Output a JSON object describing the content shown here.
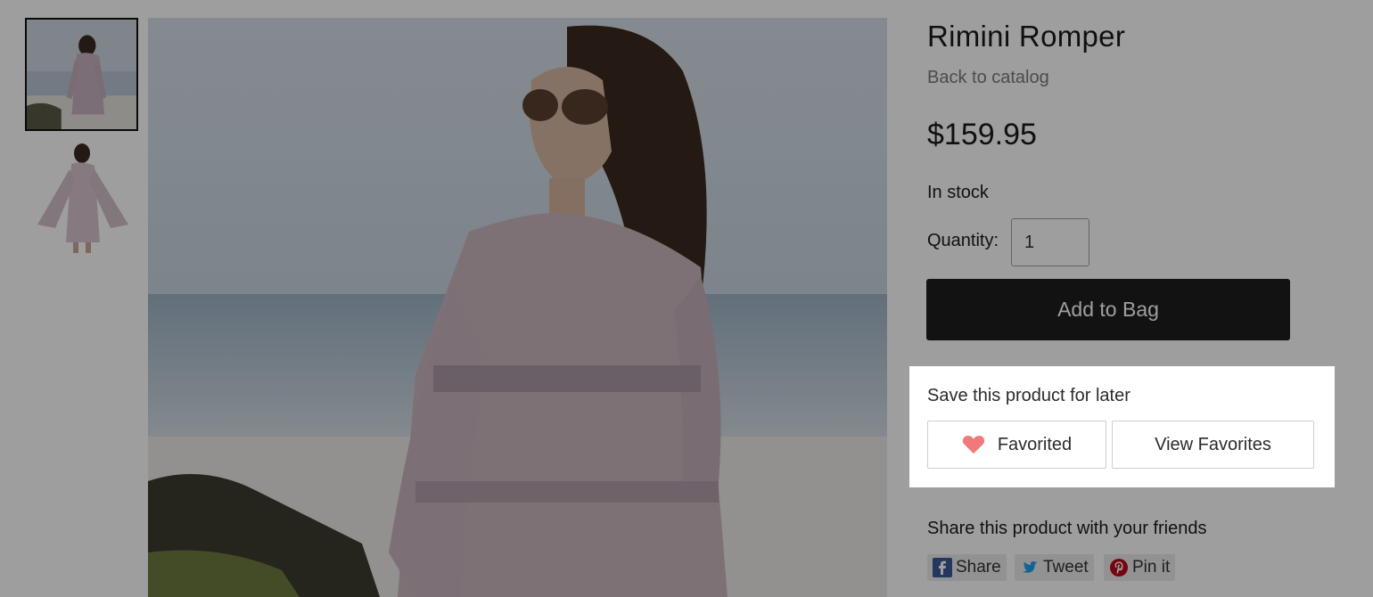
{
  "product": {
    "title": "Rimini Romper",
    "back_link": "Back to catalog",
    "price": "$159.95",
    "stock_status": "In stock",
    "quantity_label": "Quantity:",
    "quantity_value": "1",
    "add_button": "Add to Bag"
  },
  "favorites": {
    "heading": "Save this product for later",
    "favorited_label": "Favorited",
    "view_label": "View Favorites",
    "heart_color": "#f07a7a",
    "state": "favorited"
  },
  "share": {
    "heading": "Share this product with your friends",
    "buttons": [
      {
        "label": "Share",
        "icon": "facebook-icon",
        "color": "#3b5998"
      },
      {
        "label": "Tweet",
        "icon": "twitter-icon",
        "color": "#1da1f2"
      },
      {
        "label": "Pin it",
        "icon": "pinterest-icon",
        "color": "#bd081c"
      }
    ]
  },
  "gallery": {
    "selected_index": 0,
    "thumbnails": [
      "thumbnail-photo-1",
      "thumbnail-photo-2"
    ]
  },
  "colors": {
    "overlay": "#000000",
    "primary_button": "#1e1e1e"
  }
}
